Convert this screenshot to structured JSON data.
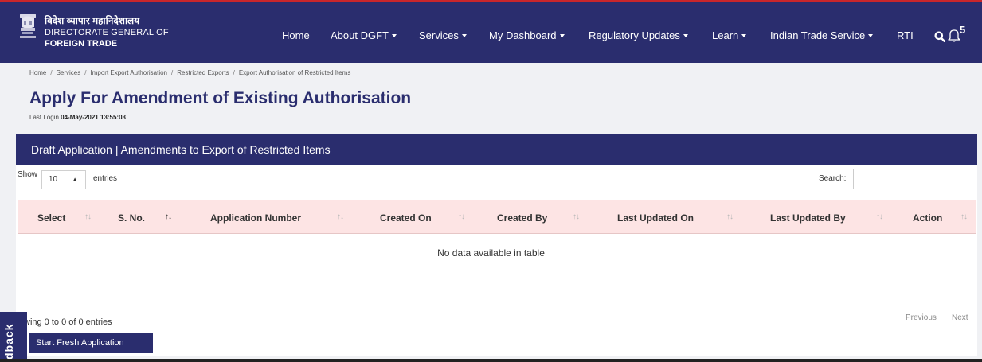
{
  "header": {
    "logo_hindi": "विदेश व्यापार महानिदेशालय",
    "logo_line2": "DIRECTORATE GENERAL OF",
    "logo_line3": "FOREIGN TRADE",
    "nav": [
      {
        "label": "Home",
        "dropdown": false
      },
      {
        "label": "About DGFT",
        "dropdown": true
      },
      {
        "label": "Services",
        "dropdown": true
      },
      {
        "label": "My Dashboard",
        "dropdown": true
      },
      {
        "label": "Regulatory Updates",
        "dropdown": true
      },
      {
        "label": "Learn",
        "dropdown": true
      },
      {
        "label": "Indian Trade Service",
        "dropdown": true
      },
      {
        "label": "RTI",
        "dropdown": false
      }
    ],
    "icons": {
      "search": "search-icon",
      "notifications": "bell-icon"
    },
    "notification_count": "5"
  },
  "breadcrumb": [
    "Home",
    "Services",
    "Import Export Authorisation",
    "Restricted Exports",
    "Export Authorisation of Restricted Items"
  ],
  "page": {
    "title": "Apply For Amendment of Existing Authorisation",
    "last_login_label": "Last Login",
    "last_login_value": "04-May-2021 13:55:03"
  },
  "card": {
    "header": "Draft Application | Amendments to Export of Restricted Items"
  },
  "table": {
    "show_label": "Show",
    "entries_value": "10",
    "entries_label": "entries",
    "search_label": "Search:",
    "columns": [
      "Select",
      "S. No.",
      "Application Number",
      "Created On",
      "Created By",
      "Last Updated On",
      "Last Updated By",
      "Action"
    ],
    "empty_message": "No data available in table",
    "info": "wing 0 to 0 of 0 entries",
    "prev": "Previous",
    "next": "Next"
  },
  "actions": {
    "start_fresh": "Start Fresh Application"
  },
  "feedback": {
    "label": "dback"
  },
  "colors": {
    "navy": "#2a2d6e",
    "header_row": "#fde4e4",
    "accent_red": "#c9262b"
  }
}
